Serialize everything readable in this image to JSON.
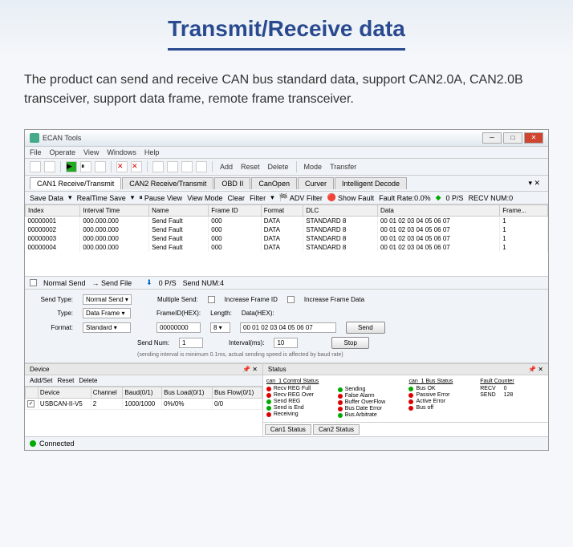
{
  "page": {
    "heading": "Transmit/Receive data",
    "description": "The product can send and receive CAN bus standard data, support CAN2.0A, CAN2.0B transceiver, support data frame, remote frame transceiver."
  },
  "app": {
    "title": "ECAN Tools",
    "menus": [
      "File",
      "Operate",
      "View",
      "Windows",
      "Help"
    ],
    "toolbar_actions": {
      "add": "Add",
      "reset": "Reset",
      "delete": "Delete",
      "mode": "Mode",
      "transfer": "Transfer"
    },
    "tabs": [
      "CAN1 Receive/Transmit",
      "CAN2 Receive/Transmit",
      "OBD II",
      "CanOpen",
      "Curver",
      "Intelligent Decode"
    ],
    "secondary": {
      "save_data": "Save Data",
      "realtime_save": "RealTime Save",
      "pause_view": "Pause View",
      "view_mode": "View Mode",
      "clear": "Clear",
      "filter": "Filter",
      "adv_filter": "ADV Filter",
      "show_fault": "Show Fault",
      "fault_rate_label": "Fault Rate:0.0%",
      "speed": "0 P/S",
      "recv_num": "RECV NUM:0"
    },
    "columns": [
      "Index",
      "Interval Time",
      "Name",
      "Frame ID",
      "Format",
      "DLC",
      "Data",
      "Frame..."
    ],
    "rows": [
      {
        "index": "00000001",
        "interval": "000.000.000",
        "name": "Send Fault",
        "fid": "000",
        "fmt": "DATA",
        "dlc": "STANDARD 8",
        "data": "00 01 02 03 04 05 06 07",
        "frame": "1"
      },
      {
        "index": "00000002",
        "interval": "000.000.000",
        "name": "Send Fault",
        "fid": "000",
        "fmt": "DATA",
        "dlc": "STANDARD 8",
        "data": "00 01 02 03 04 05 06 07",
        "frame": "1"
      },
      {
        "index": "00000003",
        "interval": "000.000.000",
        "name": "Send Fault",
        "fid": "000",
        "fmt": "DATA",
        "dlc": "STANDARD 8",
        "data": "00 01 02 03 04 05 06 07",
        "frame": "1"
      },
      {
        "index": "00000004",
        "interval": "000.000.000",
        "name": "Send Fault",
        "fid": "000",
        "fmt": "DATA",
        "dlc": "STANDARD 8",
        "data": "00 01 02 03 04 05 06 07",
        "frame": "1"
      }
    ],
    "send_tabs": {
      "normal": "Normal Send",
      "file": "Send File",
      "ps": "0 P/S",
      "num": "Send NUM:4"
    },
    "transmit": {
      "send_type_label": "Send Type:",
      "send_type": "Normal Send",
      "type_label": "Type:",
      "type": "Data Frame",
      "format_label": "Format:",
      "format": "Standard",
      "multiple": "Multiple Send:",
      "inc_frame_id": "Increase Frame ID",
      "inc_frame_data": "Increase Frame Data",
      "frame_id_label": "FrameID(HEX):",
      "frame_id": "00000000",
      "length_label": "Length:",
      "length": "8",
      "data_label": "Data(HEX):",
      "data": "00 01 02 03 04 05 06 07",
      "send_num_label": "Send Num:",
      "send_num": "1",
      "interval_label": "Interval(ms):",
      "interval": "10",
      "send_btn": "Send",
      "stop_btn": "Stop",
      "note": "(sending interval is minimum 0.1ms, actual sending speed is affected by baud rate)"
    },
    "device": {
      "title": "Device",
      "add_set": "Add/Set",
      "reset": "Reset",
      "delete": "Delete",
      "cols": [
        "Device",
        "Channel",
        "Baud(0/1)",
        "Bus Load(0/1)",
        "Bus Flow(0/1)"
      ],
      "row": {
        "dev": "USBCAN-II-V5",
        "ch": "2",
        "baud": "1000/1000",
        "load": "0%/0%",
        "flow": "0/0"
      }
    },
    "status": {
      "title": "Status",
      "col1_title": "can_1 Control Status",
      "col1": [
        "Recv REG Full",
        "Recv REG Over",
        "Send REG",
        "Send is End",
        "Receiving"
      ],
      "col2": [
        "Sending",
        "False Alarm",
        "Buffer OverFlow",
        "Bus Date Error",
        "Bus Arbitrate"
      ],
      "col3_title": "can_1 Bus Status",
      "col3": [
        "Bus OK",
        "Passive Error",
        "Active Error",
        "Bus off"
      ],
      "counter_title": "Fault Counter",
      "recv": "RECV",
      "recv_val": "0",
      "send": "SEND",
      "send_val": "128",
      "tabs": [
        "Can1 Status",
        "Can2 Status"
      ]
    },
    "statusbar": "Connected"
  }
}
